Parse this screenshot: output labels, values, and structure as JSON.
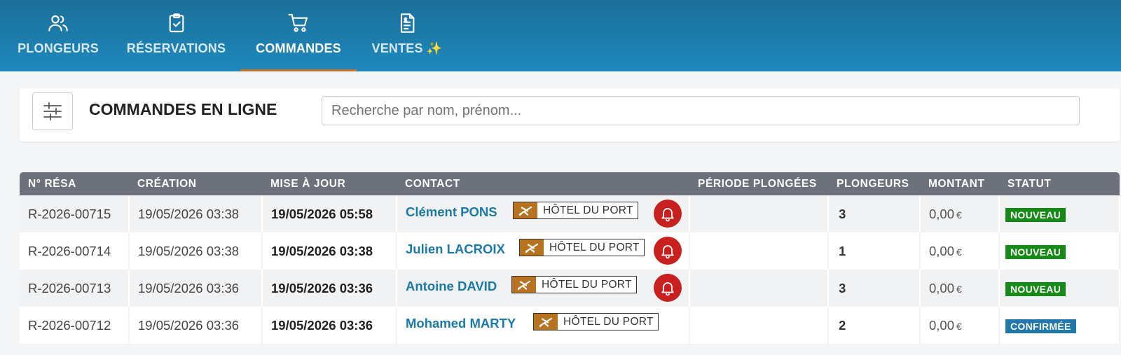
{
  "nav": {
    "tabs": [
      {
        "label": "PLONGEURS",
        "icon": "users-icon",
        "active": false
      },
      {
        "label": "RÉSERVATIONS",
        "icon": "clipboard-check-icon",
        "active": false
      },
      {
        "label": "COMMANDES",
        "icon": "shopping-cart-icon",
        "active": true
      },
      {
        "label": "VENTES ✨",
        "icon": "invoice-icon",
        "active": false
      }
    ]
  },
  "header": {
    "title": "COMMANDES EN LIGNE",
    "search_placeholder": "Recherche par nom, prénom..."
  },
  "table": {
    "columns": [
      "N° RÉSA",
      "CRÉATION",
      "MISE À JOUR",
      "CONTACT",
      "PÉRIODE PLONGÉES",
      "PLONGEURS",
      "MONTANT",
      "STATUT"
    ],
    "currency": "€",
    "rows": [
      {
        "resa": "R-2026-00715",
        "created": "19/05/2026 03:38",
        "updated": "19/05/2026 05:58",
        "contact": "Clément PONS",
        "hotel": "HÔTEL DU PORT",
        "alert": true,
        "period": "",
        "divers": "3",
        "amount": "0,00",
        "status": "NOUVEAU",
        "status_kind": "new"
      },
      {
        "resa": "R-2026-00714",
        "created": "19/05/2026 03:38",
        "updated": "19/05/2026 03:38",
        "contact": "Julien LACROIX",
        "hotel": "HÔTEL DU PORT",
        "alert": true,
        "period": "",
        "divers": "1",
        "amount": "0,00",
        "status": "NOUVEAU",
        "status_kind": "new"
      },
      {
        "resa": "R-2026-00713",
        "created": "19/05/2026 03:36",
        "updated": "19/05/2026 03:36",
        "contact": "Antoine DAVID",
        "hotel": "HÔTEL DU PORT",
        "alert": true,
        "period": "",
        "divers": "3",
        "amount": "0,00",
        "status": "NOUVEAU",
        "status_kind": "new"
      },
      {
        "resa": "R-2026-00712",
        "created": "19/05/2026 03:36",
        "updated": "19/05/2026 03:36",
        "contact": "Mohamed MARTY",
        "hotel": "HÔTEL DU PORT",
        "alert": false,
        "period": "",
        "divers": "2",
        "amount": "0,00",
        "status": "CONFIRMÉE",
        "status_kind": "confirmed"
      }
    ]
  },
  "colors": {
    "nav_bg": "#1d88bd",
    "active_underline": "#c9702c",
    "contact_link": "#1b7aa6",
    "alert_bell": "#c8201f",
    "status_new": "#168a16",
    "status_confirmed": "#2077a8",
    "hotel_tag": "#b7731f"
  }
}
